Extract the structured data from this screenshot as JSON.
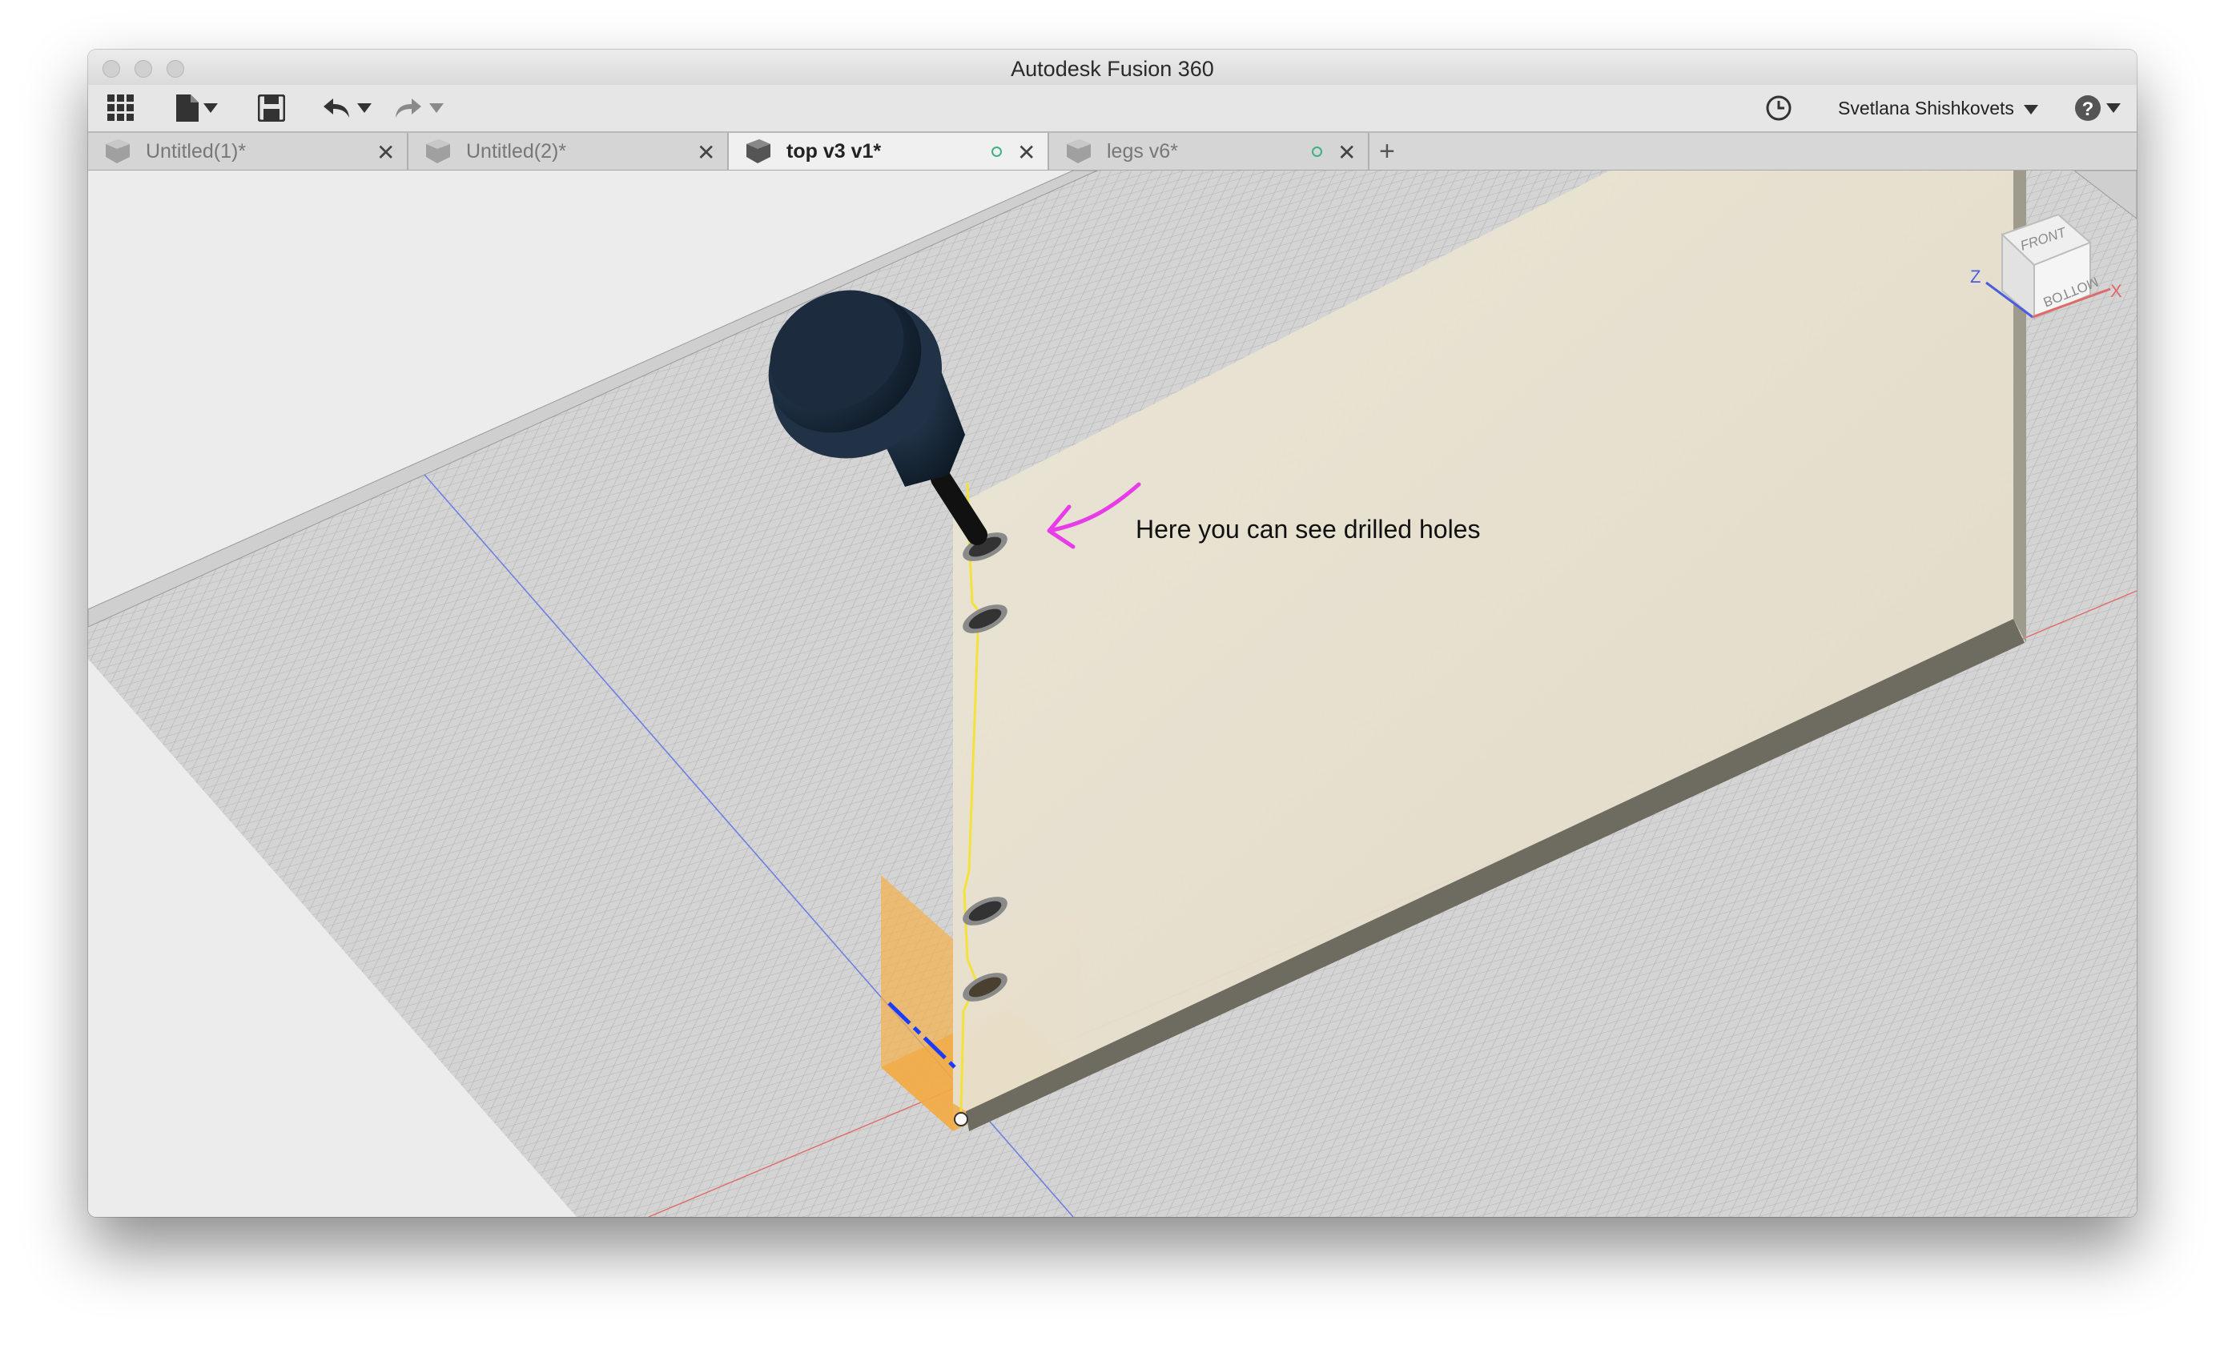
{
  "window": {
    "title": "Autodesk Fusion 360"
  },
  "toolbar": {
    "data_panel_icon": "grid-icon",
    "file_icon": "file-icon",
    "save_icon": "save-icon",
    "undo_icon": "undo-icon",
    "redo_icon": "redo-icon",
    "job_status_icon": "clock-icon",
    "user_name": "Svetlana Shishkovets",
    "help_icon": "help-icon"
  },
  "tabs": [
    {
      "label": "Untitled(1)*",
      "active": false,
      "synced": false
    },
    {
      "label": "Untitled(2)*",
      "active": false,
      "synced": false
    },
    {
      "label": "top v3 v1*",
      "active": true,
      "synced": true
    },
    {
      "label": "legs v6*",
      "active": false,
      "synced": true
    }
  ],
  "viewport": {
    "annotation": "Here you can see drilled holes",
    "viewcube": {
      "front": "FRONT",
      "bottom": "BOTTOM",
      "axis_z": "Z",
      "axis_x": "X"
    }
  },
  "colors": {
    "panel": "#e4dcc8",
    "panel_edge": "#6e6b60",
    "annotation_arrow": "#e83ce8",
    "sketch": "#f4e13a",
    "drill": "#1a2a3a"
  }
}
